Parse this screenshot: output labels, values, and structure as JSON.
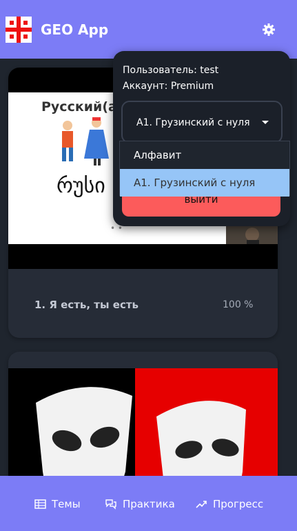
{
  "header": {
    "app_title": "GEO App"
  },
  "cards": [
    {
      "thumbnail_text": "Русский(ая",
      "thumbnail_georgian": "რუსი",
      "title": "1. Я есть, ты есть",
      "progress": "100 %"
    }
  ],
  "dropdown": {
    "user_line": "Пользователь: test",
    "account_line": "Аккаунт: Premium",
    "course_select_value": "A1. Грузинский с нуля",
    "course_options": [
      "Алфавит",
      "A1. Грузинский с нуля"
    ],
    "logout_label": "выйти"
  },
  "bottom_nav": {
    "items": [
      "Темы",
      "Практика",
      "Прогресс"
    ]
  },
  "colors": {
    "accent": "#7c7cf6",
    "background": "#1f252e",
    "card": "#262c37",
    "logout": "#fc5b5b",
    "option_highlight": "#96c5f7"
  }
}
